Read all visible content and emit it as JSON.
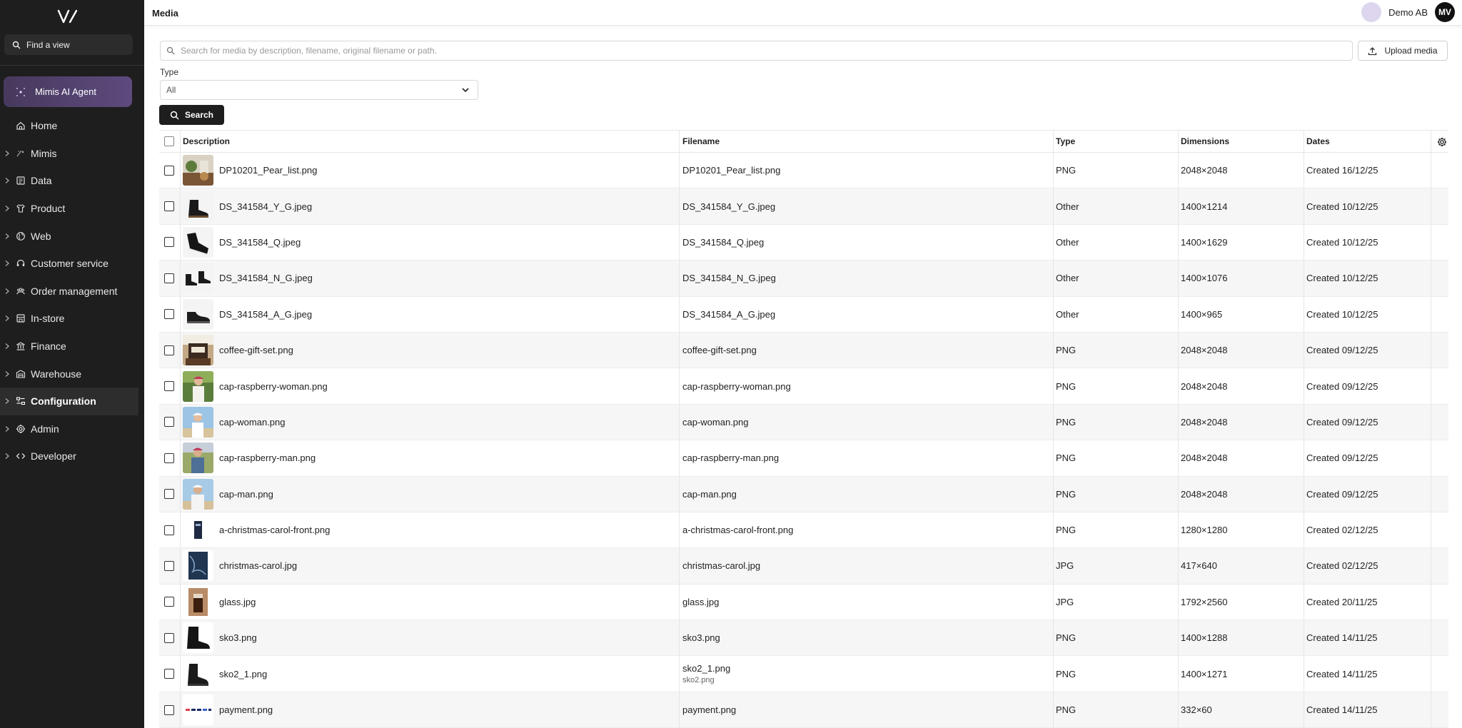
{
  "sidebar": {
    "find_label": "Find a view",
    "agent_label": "Mimis AI Agent",
    "items": [
      {
        "label": "Home",
        "icon": "home-icon",
        "has_chevron": false,
        "active": false
      },
      {
        "label": "Mimis",
        "icon": "mimis-icon",
        "has_chevron": true,
        "active": false
      },
      {
        "label": "Data",
        "icon": "data-icon",
        "has_chevron": true,
        "active": false
      },
      {
        "label": "Product",
        "icon": "shirt-icon",
        "has_chevron": true,
        "active": false
      },
      {
        "label": "Web",
        "icon": "globe-icon",
        "has_chevron": true,
        "active": false
      },
      {
        "label": "Customer service",
        "icon": "headset-icon",
        "has_chevron": true,
        "active": false
      },
      {
        "label": "Order management",
        "icon": "people-icon",
        "has_chevron": true,
        "active": false
      },
      {
        "label": "In-store",
        "icon": "store-icon",
        "has_chevron": true,
        "active": false
      },
      {
        "label": "Finance",
        "icon": "bank-icon",
        "has_chevron": true,
        "active": false
      },
      {
        "label": "Warehouse",
        "icon": "warehouse-icon",
        "has_chevron": true,
        "active": false
      },
      {
        "label": "Configuration",
        "icon": "configuration-icon",
        "has_chevron": true,
        "active": true
      },
      {
        "label": "Admin",
        "icon": "gear-icon",
        "has_chevron": true,
        "active": false
      },
      {
        "label": "Developer",
        "icon": "code-icon",
        "has_chevron": true,
        "active": false
      }
    ]
  },
  "header": {
    "title": "Media",
    "org_name": "Demo AB",
    "avatar_initials": "MV"
  },
  "search": {
    "placeholder": "Search for media by description, filename, original filename or path.",
    "value": ""
  },
  "upload_label": "Upload media",
  "filters": {
    "type_label": "Type",
    "type_value": "All"
  },
  "search_button_label": "Search",
  "table": {
    "columns": {
      "description": "Description",
      "filename": "Filename",
      "type": "Type",
      "dimensions": "Dimensions",
      "dates": "Dates"
    },
    "rows": [
      {
        "description": "DP10201_Pear_list.png",
        "filename": "DP10201_Pear_list.png",
        "subname": "",
        "type": "PNG",
        "dimensions": "2048×2048",
        "date": "Created 16/12/25",
        "thumb": "food"
      },
      {
        "description": "DS_341584_Y_G.jpeg",
        "filename": "DS_341584_Y_G.jpeg",
        "subname": "",
        "type": "Other",
        "dimensions": "1400×1214",
        "date": "Created 10/12/25",
        "thumb": "boot"
      },
      {
        "description": "DS_341584_Q.jpeg",
        "filename": "DS_341584_Q.jpeg",
        "subname": "",
        "type": "Other",
        "dimensions": "1400×1629",
        "date": "Created 10/12/25",
        "thumb": "boot2"
      },
      {
        "description": "DS_341584_N_G.jpeg",
        "filename": "DS_341584_N_G.jpeg",
        "subname": "",
        "type": "Other",
        "dimensions": "1400×1076",
        "date": "Created 10/12/25",
        "thumb": "boots"
      },
      {
        "description": "DS_341584_A_G.jpeg",
        "filename": "DS_341584_A_G.jpeg",
        "subname": "",
        "type": "Other",
        "dimensions": "1400×965",
        "date": "Created 10/12/25",
        "thumb": "shoe"
      },
      {
        "description": "coffee-gift-set.png",
        "filename": "coffee-gift-set.png",
        "subname": "",
        "type": "PNG",
        "dimensions": "2048×2048",
        "date": "Created 09/12/25",
        "thumb": "coffee"
      },
      {
        "description": "cap-raspberry-woman.png",
        "filename": "cap-raspberry-woman.png",
        "subname": "",
        "type": "PNG",
        "dimensions": "2048×2048",
        "date": "Created 09/12/25",
        "thumb": "woman-green"
      },
      {
        "description": "cap-woman.png",
        "filename": "cap-woman.png",
        "subname": "",
        "type": "PNG",
        "dimensions": "2048×2048",
        "date": "Created 09/12/25",
        "thumb": "woman-sky"
      },
      {
        "description": "cap-raspberry-man.png",
        "filename": "cap-raspberry-man.png",
        "subname": "",
        "type": "PNG",
        "dimensions": "2048×2048",
        "date": "Created 09/12/25",
        "thumb": "man-field"
      },
      {
        "description": "cap-man.png",
        "filename": "cap-man.png",
        "subname": "",
        "type": "PNG",
        "dimensions": "2048×2048",
        "date": "Created 09/12/25",
        "thumb": "man-sky"
      },
      {
        "description": "a-christmas-carol-front.png",
        "filename": "a-christmas-carol-front.png",
        "subname": "",
        "type": "PNG",
        "dimensions": "1280×1280",
        "date": "Created 02/12/25",
        "thumb": "book-small"
      },
      {
        "description": "christmas-carol.jpg",
        "filename": "christmas-carol.jpg",
        "subname": "",
        "type": "JPG",
        "dimensions": "417×640",
        "date": "Created 02/12/25",
        "thumb": "book"
      },
      {
        "description": "glass.jpg",
        "filename": "glass.jpg",
        "subname": "",
        "type": "JPG",
        "dimensions": "1792×2560",
        "date": "Created 20/11/25",
        "thumb": "glass"
      },
      {
        "description": "sko3.png",
        "filename": "sko3.png",
        "subname": "",
        "type": "PNG",
        "dimensions": "1400×1288",
        "date": "Created 14/11/25",
        "thumb": "boot3"
      },
      {
        "description": "sko2_1.png",
        "filename": "sko2_1.png",
        "subname": "sko2.png",
        "type": "PNG",
        "dimensions": "1400×1271",
        "date": "Created 14/11/25",
        "thumb": "boot4"
      },
      {
        "description": "payment.png",
        "filename": "payment.png",
        "subname": "",
        "type": "PNG",
        "dimensions": "332×60",
        "date": "Created 14/11/25",
        "thumb": "payment"
      }
    ]
  }
}
